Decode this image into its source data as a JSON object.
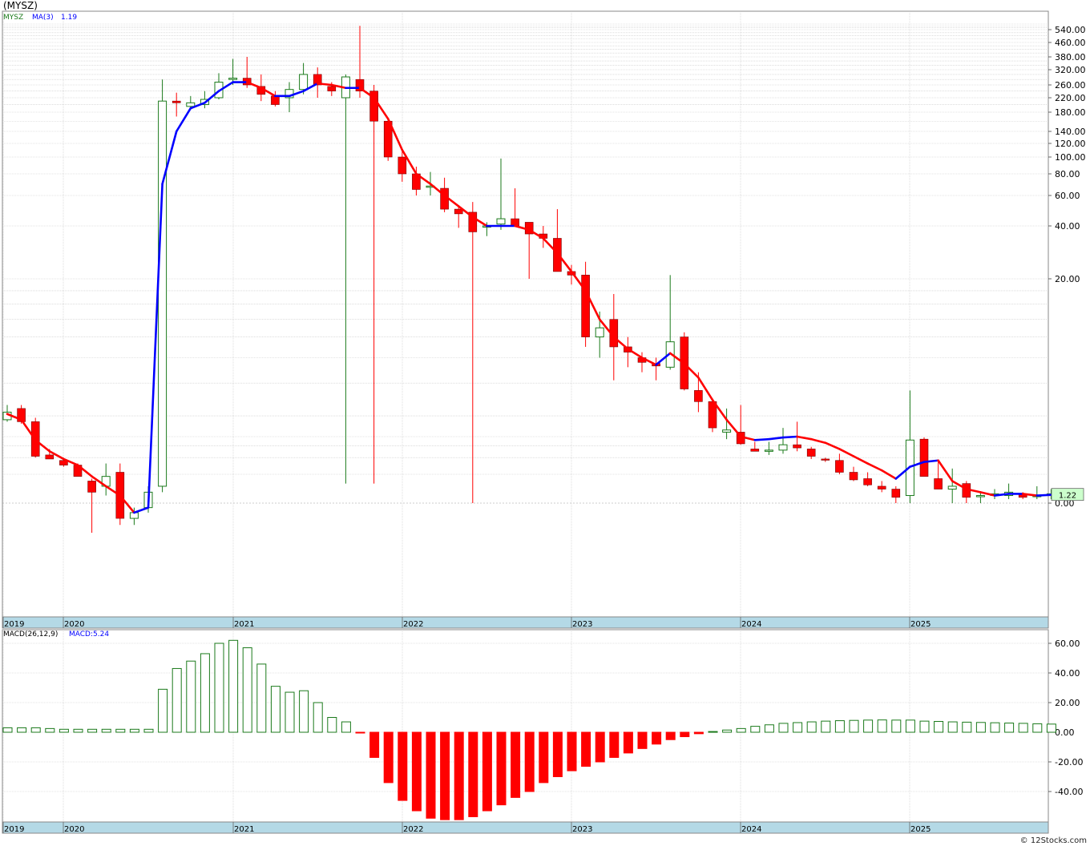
{
  "header": {
    "title": "(MYSZ)"
  },
  "legend": {
    "ticker": "MYSZ",
    "ma_label": "MA(3)",
    "ma_value": "1.19",
    "macd_label": "MACD(26,12,9)",
    "macd_value": "MACD:5.24",
    "price_tag": "1.22"
  },
  "footer": {
    "copyright": "© 12Stocks.com"
  },
  "colors": {
    "up": "#1b7a1b",
    "down": "#ff0000",
    "ma_rising": "#0000ff",
    "ma_falling": "#ff0000",
    "macd_pos": "#1b7a1b",
    "macd_neg": "#ff0000",
    "grid": "#c8c8c8",
    "axis_band": "#b4d9e6",
    "price_tag_bg": "#ccffcc"
  },
  "chart_data": [
    {
      "type": "candlestick",
      "title": "(MYSZ)",
      "scale": "log",
      "x_labels": [
        "2019",
        "2020",
        "2021",
        "2022",
        "2023",
        "2024",
        "2025"
      ],
      "y_ticks": [
        "540.00",
        "460.00",
        "380.00",
        "320.00",
        "260.00",
        "220.00",
        "180.00",
        "140.00",
        "120.00",
        "100.00",
        "80.00",
        "60.00",
        "40.00",
        "20.00",
        "0.00"
      ],
      "series": [
        {
          "name": "MYSZ",
          "candles": [
            [
              5.8,
              6.6,
              5.7,
              6.2
            ],
            [
              6.4,
              6.6,
              5.6,
              5.7
            ],
            [
              5.7,
              5.9,
              3.0,
              3.1
            ],
            [
              3.2,
              3.7,
              2.9,
              2.9
            ],
            [
              2.8,
              2.9,
              2.4,
              2.5
            ],
            [
              2.5,
              2.6,
              1.9,
              1.9
            ],
            [
              1.7,
              1.8,
              0.5,
              1.3
            ],
            [
              1.5,
              2.6,
              1.2,
              1.9
            ],
            [
              2.1,
              2.6,
              0.6,
              0.7
            ],
            [
              0.7,
              0.9,
              0.6,
              0.8
            ],
            [
              0.9,
              1.5,
              0.8,
              1.3
            ],
            [
              1.5,
              280,
              1.3,
              210
            ],
            [
              210,
              235,
              170,
              205
            ],
            [
              195,
              225,
              190,
              205
            ],
            [
              200,
              240,
              190,
              215
            ],
            [
              220,
              305,
              215,
              270
            ],
            [
              280,
              370,
              260,
              285
            ],
            [
              285,
              380,
              250,
              260
            ],
            [
              255,
              300,
              210,
              230
            ],
            [
              225,
              240,
              195,
              200
            ],
            [
              220,
              270,
              180,
              245
            ],
            [
              245,
              350,
              230,
              300
            ],
            [
              300,
              330,
              220,
              260
            ],
            [
              255,
              270,
              225,
              240
            ],
            [
              220,
              300,
              1.6,
              290
            ],
            [
              280,
              580,
              220,
              240
            ],
            [
              240,
              260,
              1.6,
              160
            ],
            [
              160,
              165,
              95,
              100
            ],
            [
              100,
              110,
              72,
              80
            ],
            [
              80,
              88,
              60,
              65
            ],
            [
              68,
              82,
              60,
              68
            ],
            [
              66,
              76,
              48,
              50
            ],
            [
              50,
              52,
              39,
              47
            ],
            [
              48,
              55,
              1.0,
              37
            ],
            [
              40,
              42,
              35,
              40
            ],
            [
              41,
              98,
              38,
              44
            ],
            [
              44,
              66,
              40,
              40
            ],
            [
              42,
              40,
              20,
              36
            ],
            [
              36,
              40,
              30,
              34
            ],
            [
              34,
              50,
              22,
              22
            ],
            [
              22,
              24,
              19,
              21
            ],
            [
              21,
              25,
              11,
              12
            ],
            [
              12,
              15,
              10,
              13
            ],
            [
              14,
              17.5,
              8.2,
              11
            ],
            [
              11,
              12,
              9.2,
              10.5
            ],
            [
              10,
              10.5,
              8.8,
              9.6
            ],
            [
              9.5,
              10,
              8.2,
              9.3
            ],
            [
              9.2,
              21,
              9.0,
              11.5
            ],
            [
              12,
              12.5,
              7.5,
              7.6
            ],
            [
              7.5,
              8.8,
              6.2,
              6.8
            ],
            [
              6.8,
              7.0,
              5.2,
              5.4
            ],
            [
              5.2,
              6.4,
              4.7,
              5.3
            ],
            [
              5.2,
              6.6,
              4.1,
              4.2
            ],
            [
              3.7,
              4.4,
              3.6,
              3.5
            ],
            [
              3.6,
              4.4,
              3.2,
              3.6
            ],
            [
              3.6,
              5.4,
              3.3,
              4.1
            ],
            [
              4.1,
              5.7,
              3.5,
              3.8
            ],
            [
              3.7,
              3.9,
              2.9,
              3.1
            ],
            [
              2.9,
              3.0,
              2.7,
              2.85
            ],
            [
              2.8,
              3.3,
              2.0,
              2.1
            ],
            [
              2.1,
              2.4,
              1.7,
              1.75
            ],
            [
              1.8,
              2.1,
              1.5,
              1.55
            ],
            [
              1.5,
              1.7,
              1.3,
              1.4
            ],
            [
              1.4,
              1.5,
              1.0,
              1.15
            ],
            [
              1.2,
              7.5,
              1.0,
              4.6
            ],
            [
              4.7,
              4.9,
              1.9,
              1.9
            ],
            [
              1.8,
              2.7,
              1.4,
              1.4
            ],
            [
              1.4,
              2.3,
              1.0,
              1.5
            ],
            [
              1.6,
              1.7,
              1.0,
              1.15
            ],
            [
              1.2,
              1.3,
              1.0,
              1.2
            ],
            [
              1.2,
              1.4,
              1.1,
              1.25
            ],
            [
              1.2,
              1.6,
              1.1,
              1.3
            ],
            [
              1.25,
              1.3,
              1.1,
              1.15
            ],
            [
              1.2,
              1.5,
              1.1,
              1.2
            ],
            [
              1.2,
              1.4,
              1.1,
              1.25
            ]
          ]
        },
        {
          "name": "MA(3)",
          "values": [
            6.1,
            5.8,
            4.6,
            3.5,
            2.9,
            2.5,
            1.9,
            1.5,
            1.2,
            0.8,
            0.9,
            70,
            140,
            190,
            205,
            240,
            270,
            270,
            250,
            225,
            225,
            240,
            265,
            260,
            250,
            250,
            220,
            165,
            110,
            80,
            70,
            60,
            52,
            45,
            40,
            40,
            40,
            38,
            34,
            28,
            22,
            18,
            14,
            12,
            10.8,
            10,
            9.4,
            10.4,
            9.5,
            8.4,
            6.9,
            5.8,
            5.0,
            4.6,
            4.7,
            4.9,
            5.0,
            4.7,
            4.3,
            3.7,
            3.1,
            2.6,
            2.2,
            1.8,
            2.4,
            2.7,
            2.8,
            1.7,
            1.4,
            1.3,
            1.2,
            1.25,
            1.25,
            1.2,
            1.22
          ]
        }
      ]
    },
    {
      "type": "bar",
      "title": "MACD(26,12,9)",
      "y_ticks": [
        "60.00",
        "40.00",
        "20.00",
        "0.00",
        "-20.00",
        "-40.00"
      ],
      "x_labels": [
        "2019",
        "2020",
        "2021",
        "2022",
        "2023",
        "2024",
        "2025"
      ],
      "series": [
        {
          "name": "MACD",
          "values": [
            3,
            3,
            3,
            2.5,
            2,
            2,
            2,
            2,
            2,
            2,
            2,
            29,
            43,
            48,
            53,
            60,
            62,
            57,
            46,
            31,
            27,
            28,
            20,
            10,
            7,
            -0.5,
            -17,
            -34,
            -46,
            -53,
            -58,
            -59,
            -59,
            -57,
            -53,
            -49,
            -44,
            -40,
            -34,
            -30,
            -26,
            -23,
            -20,
            -17,
            -14,
            -11,
            -8,
            -5,
            -3,
            -1,
            0.5,
            1.5,
            2.5,
            4,
            5,
            6,
            6.5,
            7,
            7.5,
            7.8,
            8,
            8.2,
            8.3,
            8.2,
            8.2,
            7.5,
            7.3,
            7,
            6.8,
            6.6,
            6.4,
            6.2,
            6,
            5.7,
            5.5
          ]
        }
      ]
    }
  ]
}
